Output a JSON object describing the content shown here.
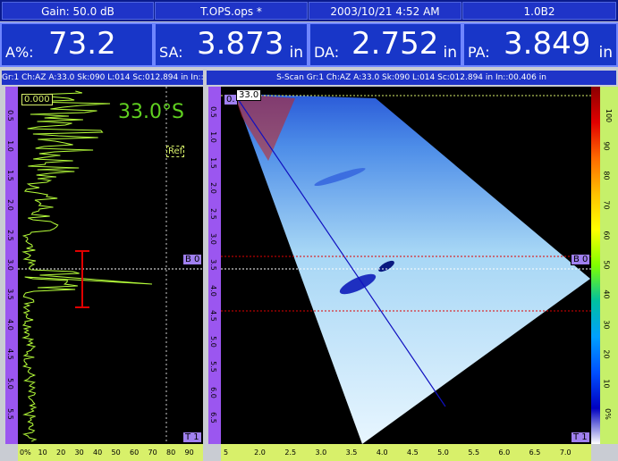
{
  "header": {
    "gain": "Gain: 50.0 dB",
    "file": "T.OPS.ops *",
    "datetime": "2003/10/21 4:52 AM",
    "version": "1.0B2"
  },
  "readouts": [
    {
      "label": "A%:",
      "value": "73.2",
      "unit": ""
    },
    {
      "label": "SA:",
      "value": "3.873",
      "unit": "in"
    },
    {
      "label": "DA:",
      "value": "2.752",
      "unit": "in"
    },
    {
      "label": "PA:",
      "value": "3.849",
      "unit": "in"
    }
  ],
  "ascan": {
    "header": "Gr:1 Ch:AZ A:33.0 Sk:090 L:014 Sc:012.894 in In::00",
    "angle": "33.0°S",
    "top_tag": "0.000",
    "ref_label": "Ref",
    "gate_label": "B 0",
    "t_label": "T 1",
    "depth_ticks": [
      "0.5",
      "1.0",
      "1.5",
      "2.0",
      "2.5",
      "3.0",
      "3.5",
      "4.0",
      "4.5",
      "5.0",
      "5.5"
    ],
    "amp_ticks": [
      "0%",
      "10",
      "20",
      "30",
      "40",
      "50",
      "60",
      "70",
      "80",
      "90"
    ]
  },
  "sscan": {
    "header": "S-Scan Gr:1 Ch:AZ A:33.0 Sk:090 L:014 Sc:012.894 in In::00.406 in",
    "cursor_tag": "33.0",
    "zero_tag": "0.",
    "gate_label": "B 0",
    "t_label": "T 1",
    "depth_ticks": [
      "0.5",
      "1.0",
      "1.5",
      "2.0",
      "2.5",
      "3.0",
      "3.5",
      "4.0",
      "4.5",
      "5.0",
      "5.5",
      "6.0",
      "6.5"
    ],
    "x_ticks": [
      "5",
      "2.0",
      "2.5",
      "3.0",
      "3.5",
      "4.0",
      "4.5",
      "5.0",
      "5.5",
      "6.0",
      "6.5",
      "7.0"
    ],
    "color_ticks": [
      "100",
      "90",
      "80",
      "70",
      "60",
      "50",
      "40",
      "30",
      "20",
      "10",
      "0%"
    ]
  },
  "colors": {
    "header_bg": "#1f34c8",
    "ascan_trace": "#b6ff3a",
    "gate_red": "#e00000",
    "ruler_purple": "#9b56f0",
    "ruler_yellow": "#d8f06a"
  }
}
